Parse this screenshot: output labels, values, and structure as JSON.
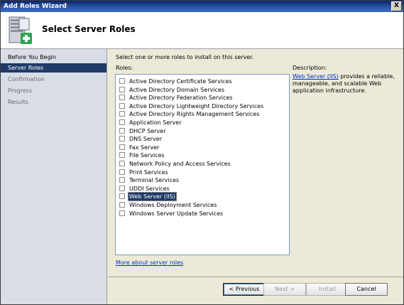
{
  "window": {
    "title": "Add Roles Wizard",
    "close_label": "X"
  },
  "header": {
    "title": "Select Server Roles"
  },
  "nav": {
    "items": [
      {
        "label": "Before You Begin"
      },
      {
        "label": "Server Roles"
      },
      {
        "label": "Confirmation"
      },
      {
        "label": "Progress"
      },
      {
        "label": "Results"
      }
    ]
  },
  "main": {
    "instruction": "Select one or more roles to install on this server.",
    "roles_label": "Roles:",
    "roles": [
      {
        "label": "Active Directory Certificate Services",
        "checked": false
      },
      {
        "label": "Active Directory Domain Services",
        "checked": false
      },
      {
        "label": "Active Directory Federation Services",
        "checked": false
      },
      {
        "label": "Active Directory Lightweight Directory Services",
        "checked": false
      },
      {
        "label": "Active Directory Rights Management Services",
        "checked": false
      },
      {
        "label": "Application Server",
        "checked": false
      },
      {
        "label": "DHCP Server",
        "checked": false
      },
      {
        "label": "DNS Server",
        "checked": false
      },
      {
        "label": "Fax Server",
        "checked": false
      },
      {
        "label": "File Services",
        "checked": false
      },
      {
        "label": "Network Policy and Access Services",
        "checked": false
      },
      {
        "label": "Print Services",
        "checked": false
      },
      {
        "label": "Terminal Services",
        "checked": false
      },
      {
        "label": "UDDI Services",
        "checked": false
      },
      {
        "label": "Web Server (IIS)",
        "checked": false,
        "selected": true
      },
      {
        "label": "Windows Deployment Services",
        "checked": false
      },
      {
        "label": "Windows Server Update Services",
        "checked": false
      }
    ],
    "description_title": "Description:",
    "description_link": "Web Server (IIS)",
    "description_text": " provides a reliable, manageable, and scalable Web application infrastructure.",
    "more_link": "More about server roles"
  },
  "footer": {
    "previous": "< Previous",
    "next": "Next >",
    "install": "Install",
    "cancel": "Cancel"
  }
}
